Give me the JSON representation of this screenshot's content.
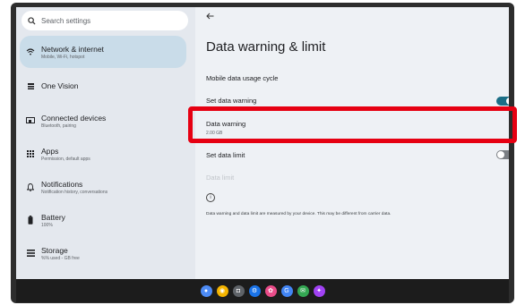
{
  "search": {
    "placeholder": "Search settings"
  },
  "sidebar": {
    "items": [
      {
        "title": "Network & internet",
        "subtitle": "Mobile, Wi-Fi, hotspot",
        "icon": "wifi-icon"
      },
      {
        "title": "One Vision",
        "subtitle": "",
        "icon": "one-vision-icon"
      },
      {
        "title": "Connected devices",
        "subtitle": "Bluetooth, pairing",
        "icon": "connected-devices-icon"
      },
      {
        "title": "Apps",
        "subtitle": "Permission, default apps",
        "icon": "apps-grid-icon"
      },
      {
        "title": "Notifications",
        "subtitle": "Notification history, conversations",
        "icon": "bell-icon"
      },
      {
        "title": "Battery",
        "subtitle": "100%",
        "icon": "battery-icon"
      },
      {
        "title": "Storage",
        "subtitle": "%% used - GB free",
        "icon": "storage-icon"
      }
    ]
  },
  "main": {
    "title": "Data warning & limit",
    "usage_cycle": "Mobile data usage cycle",
    "set_data_warning": "Set data warning",
    "data_warning": "Data warning",
    "data_warning_value": "2.00 GB",
    "set_data_limit": "Set data limit",
    "data_limit": "Data limit",
    "note": "Data warning and data limit are measured by your device. This may be different from carrier data."
  },
  "toggles": {
    "set_data_warning": "on",
    "set_data_limit": "off"
  },
  "colors": {
    "accent": "#1a6e86",
    "highlight": "#e60012",
    "selected_nav": "#c9dce9"
  },
  "taskbar": {
    "apps": [
      "assistant-app",
      "chrome-app",
      "camera-app",
      "settings-app",
      "photos-app",
      "google-app",
      "messages-app",
      "gallery-app"
    ]
  }
}
